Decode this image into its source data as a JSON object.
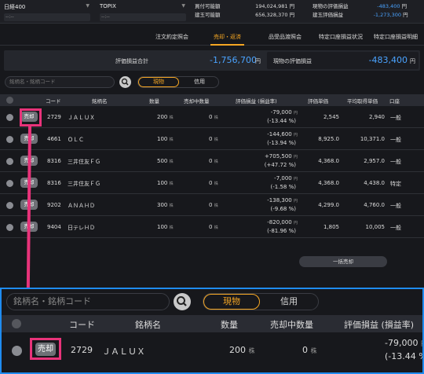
{
  "topbar": {
    "index1": {
      "name": "日経400",
      "sub": "--:--"
    },
    "index2": {
      "name": "TOPIX",
      "sub": "--:--"
    },
    "account": [
      {
        "label": "買付可能額",
        "value": "194,024,981",
        "unit": "円"
      },
      {
        "label": "建玉可能額",
        "value": "656,328,370",
        "unit": "円"
      }
    ],
    "pnl": [
      {
        "label": "現物の評価損益",
        "value": "-483,400",
        "unit": "円"
      },
      {
        "label": "建玉評価損益",
        "value": "-1,273,300",
        "unit": "円"
      }
    ]
  },
  "tabs": [
    "注文約定照会",
    "売却・返済",
    "品受品渡照会",
    "特定口座損益状況",
    "特定口座損益明細"
  ],
  "active_tab": "売却・返済",
  "summary": {
    "total_label": "評価損益合計",
    "total_value": "-1,756,700",
    "total_unit": "円",
    "spot_label": "現物の評価損益",
    "spot_value": "-483,400",
    "spot_unit": "円"
  },
  "search": {
    "placeholder": "銘柄名・銘柄コード"
  },
  "segment": {
    "a": "現物",
    "b": "信用"
  },
  "columns": [
    "コード",
    "銘柄名",
    "数量",
    "売却中数量",
    "評価損益 (損益率)",
    "評価単価",
    "平均取得単価",
    "口座"
  ],
  "sell_label": "売却",
  "share_unit": "株",
  "yen_unit": "円",
  "rows": [
    {
      "code": "2729",
      "name": "ＪＡＬＵＸ",
      "qty": "200",
      "selling": "0",
      "pl": "-79,000",
      "plr": "(-13.44 %)",
      "price": "2,545",
      "avg": "2,940",
      "acct": "一般",
      "neg": true
    },
    {
      "code": "4661",
      "name": "ＯＬＣ",
      "qty": "100",
      "selling": "0",
      "pl": "-144,600",
      "plr": "(-13.94 %)",
      "price": "8,925.0",
      "avg": "10,371.0",
      "acct": "一般",
      "neg": true
    },
    {
      "code": "8316",
      "name": "三井住友ＦＧ",
      "qty": "500",
      "selling": "0",
      "pl": "+705,500",
      "plr": "(+47.72 %)",
      "price": "4,368.0",
      "avg": "2,957.0",
      "acct": "一般",
      "neg": false
    },
    {
      "code": "8316",
      "name": "三井住友ＦＧ",
      "qty": "100",
      "selling": "0",
      "pl": "-7,000",
      "plr": "(-1.58 %)",
      "price": "4,368.0",
      "avg": "4,438.0",
      "acct": "特定",
      "neg": true
    },
    {
      "code": "9202",
      "name": "ＡＮＡＨＤ",
      "qty": "300",
      "selling": "0",
      "pl": "-138,300",
      "plr": "(-9.68 %)",
      "price": "4,299.0",
      "avg": "4,760.0",
      "acct": "一般",
      "neg": true
    },
    {
      "code": "9404",
      "name": "日テレＨＤ",
      "qty": "100",
      "selling": "0",
      "pl": "-820,000",
      "plr": "(-81.96 %)",
      "price": "1,805",
      "avg": "10,005",
      "acct": "一般",
      "neg": true
    }
  ],
  "bulk_label": "一括売却",
  "zoom": {
    "search_placeholder": "銘柄名・銘柄コード",
    "seg_a": "現物",
    "seg_b": "信用",
    "columns": [
      "コード",
      "銘柄名",
      "数量",
      "売却中数量",
      "評価損益 (損益率)"
    ],
    "row": {
      "code": "2729",
      "name": "ＪＡＬＵＸ",
      "qty": "200",
      "selling": "0",
      "pl": "-79,000",
      "plr": "(-13.44 %)"
    }
  },
  "colors": {
    "accent": "#f5a623",
    "negative": "#4aa3ff",
    "positive": "#ff5566",
    "highlight": "#e8337a",
    "zoom_border": "#1f8cf0"
  }
}
